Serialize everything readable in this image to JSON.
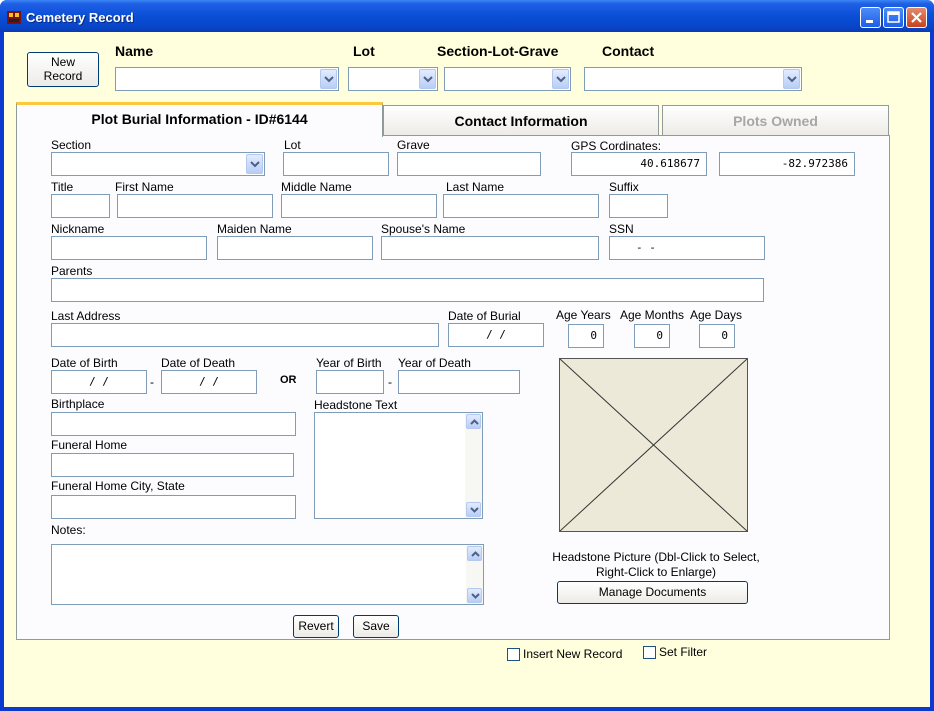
{
  "window": {
    "title": "Cemetery Record"
  },
  "toolbar": {
    "new_record_line1": "New",
    "new_record_line2": "Record",
    "name_label": "Name",
    "lot_label": "Lot",
    "section_lot_grave_label": "Section-Lot-Grave",
    "contact_label": "Contact"
  },
  "tabs": [
    {
      "label": "Plot Burial Information - ID#6144",
      "active": true
    },
    {
      "label": "Contact Information",
      "active": false
    },
    {
      "label": "Plots Owned",
      "active": false,
      "disabled": true
    }
  ],
  "form": {
    "section_label": "Section",
    "lot_label": "Lot",
    "grave_label": "Grave",
    "gps_label": "GPS Cordinates:",
    "gps_lat": "40.618677",
    "gps_lon": "-82.972386",
    "title_label": "Title",
    "first_name_label": "First Name",
    "middle_name_label": "Middle Name",
    "last_name_label": "Last Name",
    "suffix_label": "Suffix",
    "nickname_label": "Nickname",
    "maiden_name_label": "Maiden Name",
    "spouse_name_label": "Spouse's Name",
    "ssn_label": "SSN",
    "ssn_value": "-   -",
    "parents_label": "Parents",
    "last_address_label": "Last Address",
    "date_of_burial_label": "Date of Burial",
    "date_of_burial_value": "/   /",
    "age_years_label": "Age Years",
    "age_months_label": "Age Months",
    "age_days_label": "Age Days",
    "age_years_value": "0",
    "age_months_value": "0",
    "age_days_value": "0",
    "date_of_birth_label": "Date of Birth",
    "date_of_death_label": "Date of Death",
    "date_of_birth_value": "/   /",
    "date_of_death_value": "/   /",
    "date_sep": "-",
    "or_label": "OR",
    "year_of_birth_label": "Year of Birth",
    "year_of_death_label": "Year of Death",
    "year_sep": "-",
    "birthplace_label": "Birthplace",
    "headstone_text_label": "Headstone Text",
    "funeral_home_label": "Funeral Home",
    "funeral_home_city_label": "Funeral Home City, State",
    "notes_label": "Notes:",
    "picture_caption_line1": "Headstone Picture (Dbl-Click to Select,",
    "picture_caption_line2": "Right-Click to Enlarge)",
    "manage_documents_label": "Manage Documents"
  },
  "footer": {
    "revert_label": "Revert",
    "save_label": "Save",
    "insert_new_record_label": "Insert New Record",
    "set_filter_label": "Set Filter",
    "insert_new_record_checked": false,
    "set_filter_checked": false
  }
}
